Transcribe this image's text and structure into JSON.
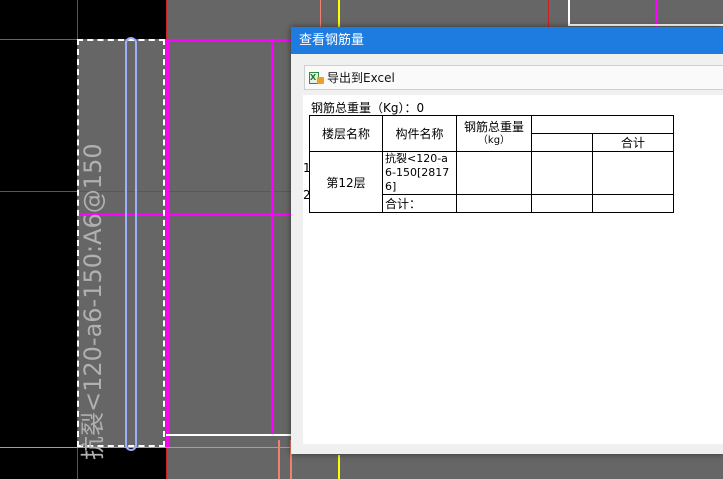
{
  "canvas": {
    "annotation_text": "抗裂<120-a6-150:A6@150",
    "colors": {
      "background": "#000000",
      "panel": "#666666",
      "grid_red": "#cc2222",
      "magenta": "#ff00ff",
      "yellow": "#ffff00",
      "salmon": "#f08070",
      "green": "#00aa00",
      "rebar": "#9db0ff"
    }
  },
  "dialog": {
    "title": "查看钢筋量",
    "title_bg": "#1e7be0",
    "toolbar": {
      "export_label": "导出到Excel",
      "icon": "excel-export-icon"
    },
    "summary": "钢筋总重量（Kg）：0",
    "table": {
      "headers": {
        "floor": "楼层名称",
        "component": "构件名称",
        "total_weight": "钢筋总重量",
        "total_weight_unit": "（kg）",
        "subtotal": "合计"
      },
      "row_numbers": [
        "1",
        "2"
      ],
      "floor_name": "第12层",
      "component_name": "抗裂<120-a6-150[28176]",
      "sum_label": "合计："
    }
  }
}
